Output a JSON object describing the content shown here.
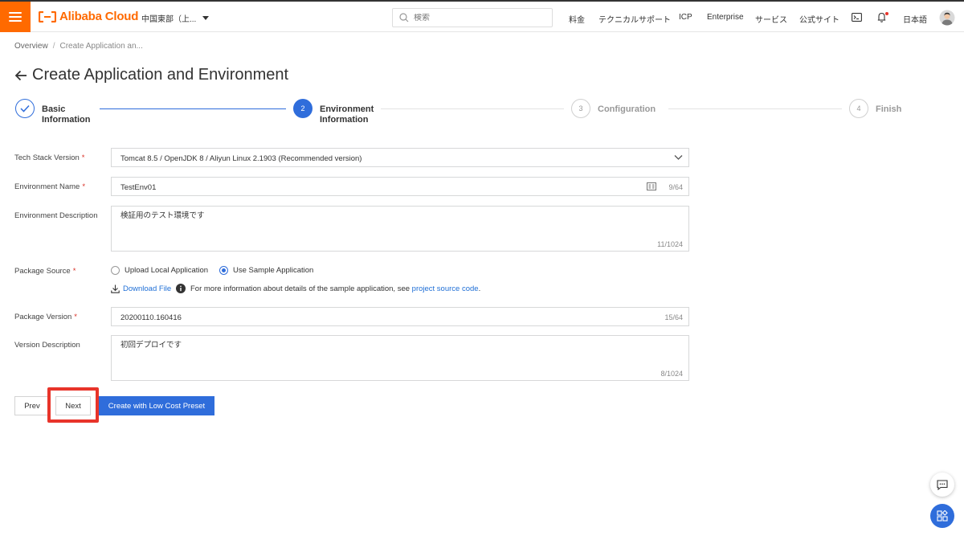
{
  "topbar": {
    "logo_text": "Alibaba Cloud",
    "region": "中国東部（上...",
    "search_placeholder": "検索",
    "nav": [
      "料金",
      "テクニカルサポート",
      "ICP",
      "Enterprise",
      "サービス",
      "公式サイト"
    ],
    "language": "日本語"
  },
  "breadcrumb": {
    "root": "Overview",
    "separator": "/",
    "current": "Create Application an..."
  },
  "page": {
    "title": "Create Application and Environment"
  },
  "steps": [
    {
      "number": "1",
      "line1": "Basic",
      "line2": "Information",
      "state": "done"
    },
    {
      "number": "2",
      "line1": "Environment",
      "line2": "Information",
      "state": "active"
    },
    {
      "number": "3",
      "line1": "Configuration",
      "line2": "",
      "state": "pending"
    },
    {
      "number": "4",
      "line1": "Finish",
      "line2": "",
      "state": "pending"
    }
  ],
  "form": {
    "tech_stack": {
      "label": "Tech Stack Version",
      "value": "Tomcat 8.5 / OpenJDK 8 / Aliyun Linux 2.1903  (Recommended version)"
    },
    "env_name": {
      "label": "Environment Name",
      "value": "TestEnv01",
      "counter": "9/64"
    },
    "env_desc": {
      "label": "Environment Description",
      "value": "検証用のテスト環境です",
      "counter": "11/1024"
    },
    "package_source": {
      "label": "Package Source",
      "options": [
        "Upload Local Application",
        "Use Sample Application"
      ],
      "selected": "Use Sample Application",
      "download_link": "Download File",
      "info_text": "For more information about details of the sample application, see",
      "source_link": "project source code",
      "period": "."
    },
    "package_version": {
      "label": "Package Version",
      "value": "20200110.160416",
      "counter": "15/64"
    },
    "version_desc": {
      "label": "Version Description",
      "value": "初回デプロイです",
      "counter": "8/1024"
    }
  },
  "buttons": {
    "prev": "Prev",
    "next": "Next",
    "create": "Create with Low Cost Preset"
  },
  "colors": {
    "brand": "#ff6a00",
    "primary": "#2f6ddb",
    "highlight": "#e8342a",
    "required": "#d93026"
  }
}
